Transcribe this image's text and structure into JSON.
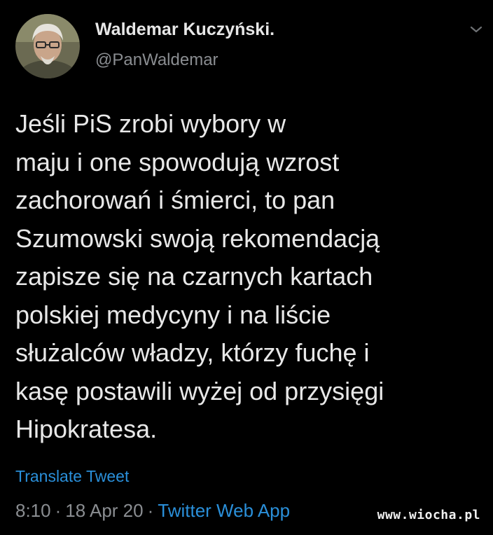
{
  "author": {
    "display_name": "Waldemar Kuczyński.",
    "handle": "@PanWaldemar"
  },
  "tweet": {
    "lines": [
      "Jeśli PiS zrobi wybory w",
      "maju i one spowodują wzrost",
      "zachorowań i śmierci, to pan",
      "Szumowski swoją rekomendacją",
      "zapisze się na czarnych kartach",
      "polskiej medycyny i na liście",
      "służalców władzy, którzy fuchę i",
      "kasę postawili wyżej od przysięgi",
      "Hipokratesa."
    ],
    "translate_label": "Translate Tweet",
    "time": "8:10",
    "date": "18 Apr 20",
    "separator": "·",
    "source_app": "Twitter Web App"
  },
  "watermark": "www.wiocha.pl",
  "icons": {
    "menu": "chevron-down-icon",
    "avatar": "avatar"
  },
  "colors": {
    "background": "#000000",
    "text": "#e8e8e8",
    "secondary": "#8a8d91",
    "link": "#2a8fd9"
  }
}
